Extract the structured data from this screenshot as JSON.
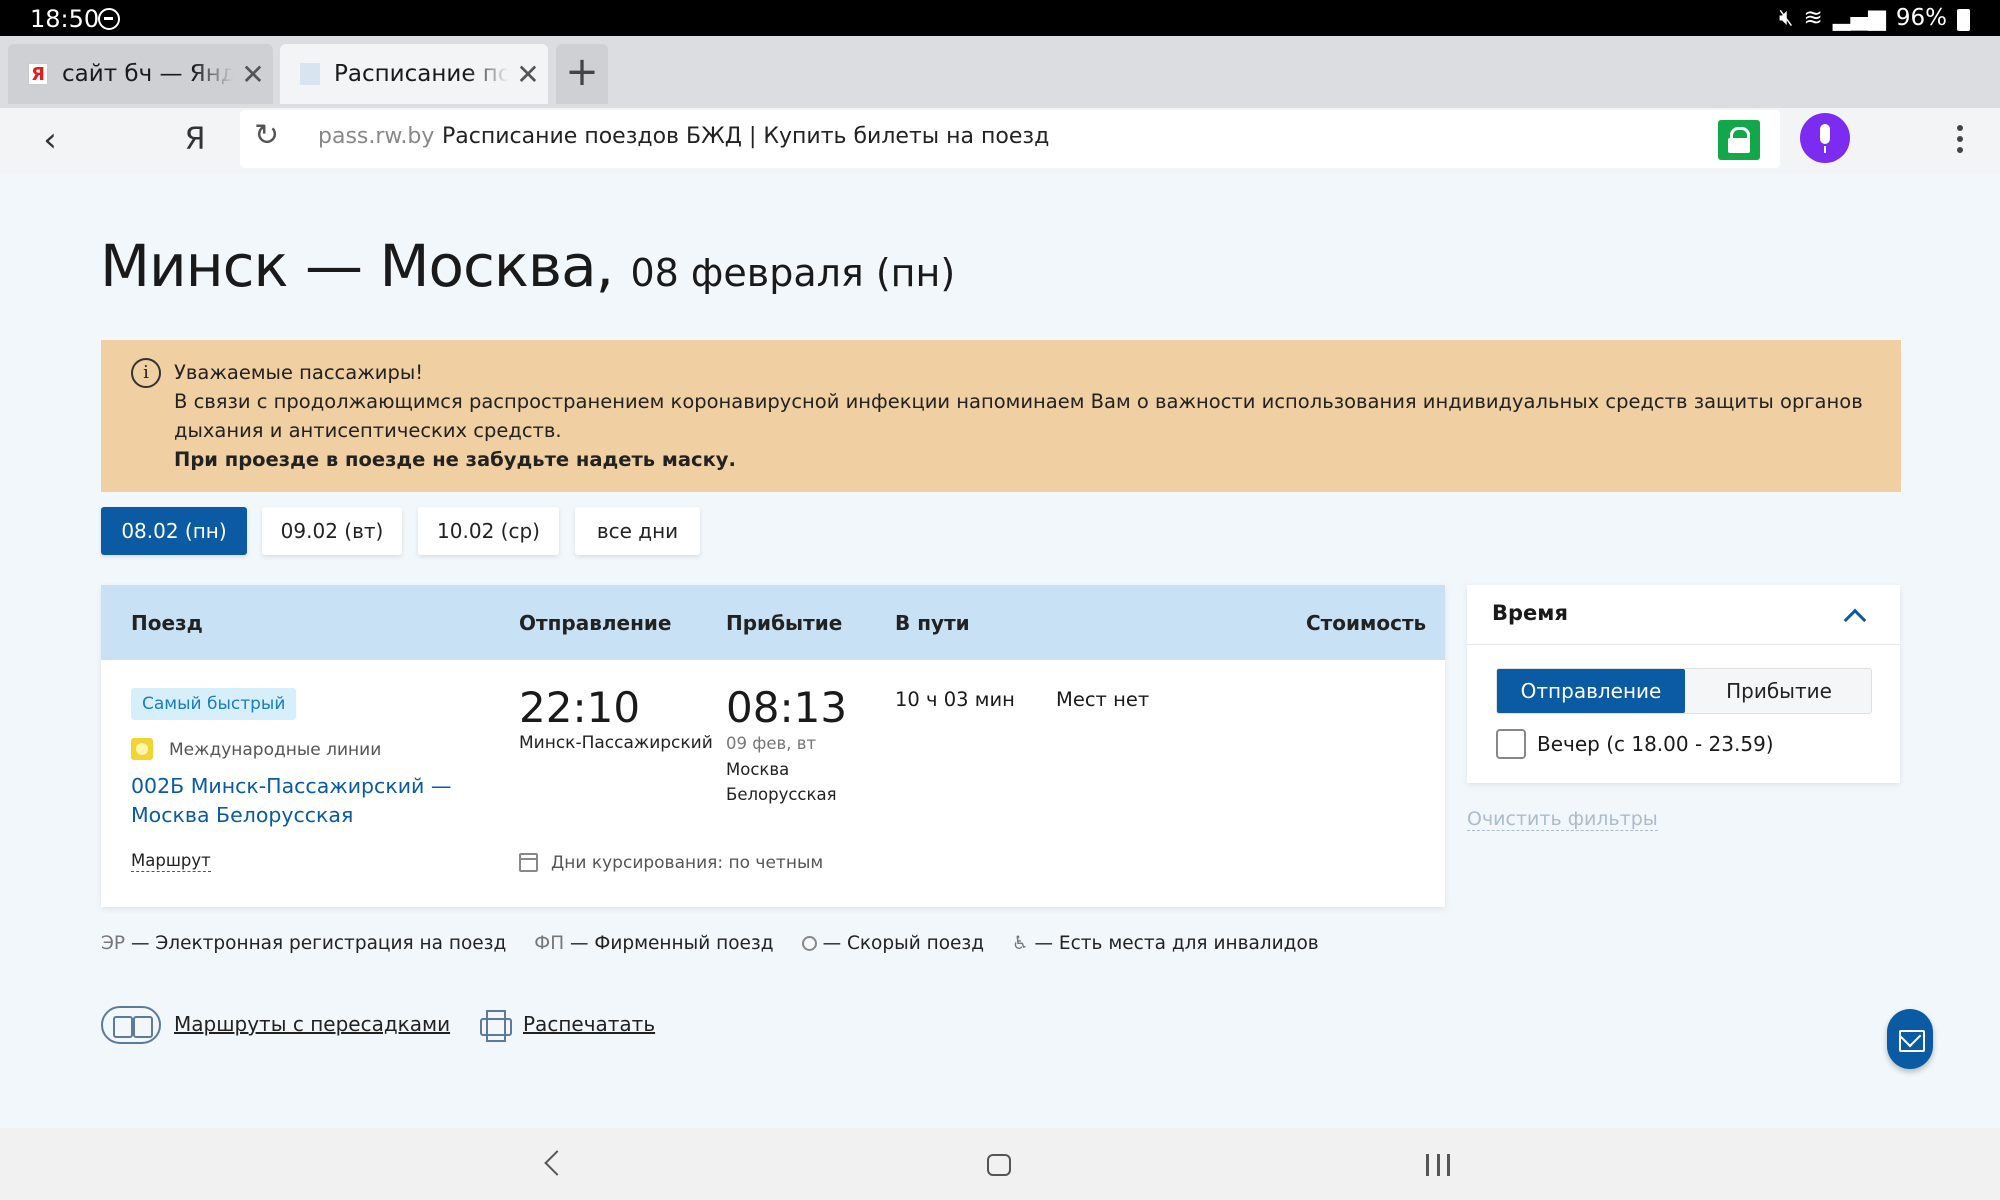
{
  "status_bar": {
    "time": "18:50",
    "battery": "96%"
  },
  "tabs": [
    {
      "title": "сайт бч — Яндекс",
      "favicon": "Я",
      "active": false
    },
    {
      "title": "Расписание поездов",
      "active": true
    }
  ],
  "address_bar": {
    "host": "pass.rw.by",
    "page_title": "Расписание поездов БЖД | Купить билеты на поезд",
    "yandex_label": "Я"
  },
  "page": {
    "route": "Минск — Москва,",
    "date": "08 февраля (пн)"
  },
  "notice": {
    "heading": "Уважаемые пассажиры!",
    "body": "В связи с продолжающимся распространением коронавирусной инфекции напоминаем Вам о важности использования индивидуальных средств защиты органов дыхания и антисептических средств.",
    "bold": "При проезде в поезде не забудьте надеть маску."
  },
  "date_buttons": [
    "08.02 (пн)",
    "09.02 (вт)",
    "10.02 (ср)",
    "все дни"
  ],
  "table": {
    "headers": {
      "train": "Поезд",
      "departure": "Отправление",
      "arrival": "Прибытие",
      "duration": "В пути",
      "cost": "Стоимость"
    },
    "row": {
      "tag": "Самый быстрый",
      "line_type": "Международные линии",
      "train_name": "002Б Минск-Пассажирский — Москва Белорусская",
      "route_link": "Маршрут",
      "dep_time": "22:10",
      "dep_station": "Минск-Пассажирский",
      "arr_time": "08:13",
      "arr_date": "09 фев, вт",
      "arr_station": "Москва Белорусская",
      "duration": "10 ч 03 мин",
      "seats": "Мест нет",
      "schedule": "Дни курсирования: по четным"
    }
  },
  "filter": {
    "title": "Время",
    "seg_departure": "Отправление",
    "seg_arrival": "Прибытие",
    "checkbox_label": "Вечер (с 18.00 - 23.59)",
    "clear": "Очистить фильтры"
  },
  "legend": [
    {
      "key": "ЭР",
      "text": "— Электронная регистрация на поезд"
    },
    {
      "key": "ФП",
      "text": "— Фирменный поезд"
    },
    {
      "key": "",
      "text": "— Скорый поезд"
    },
    {
      "key": "♿",
      "text": "— Есть места для инвалидов"
    }
  ],
  "bottom_links": {
    "transfers": "Маршруты с пересадками",
    "print": "Распечатать"
  },
  "colors": {
    "primary": "#0a5ba3",
    "notice_bg": "#f0cfa2",
    "table_header": "#c8e1f4",
    "mic": "#7b2cf0",
    "lock": "#12a84a"
  }
}
